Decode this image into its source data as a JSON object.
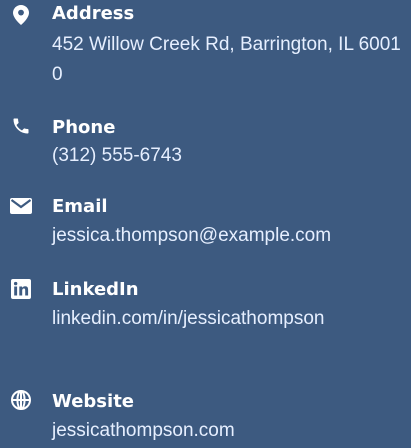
{
  "contact": {
    "items": [
      {
        "icon": "map-pin-icon",
        "label": "Address",
        "value": "452 Willow Creek Rd, Barrington, IL 60010"
      },
      {
        "icon": "phone-icon",
        "label": "Phone",
        "value": "(312) 555-6743"
      },
      {
        "icon": "envelope-icon",
        "label": "Email",
        "value": "jessica.thompson@example.com"
      },
      {
        "icon": "linkedin-icon",
        "label": "LinkedIn",
        "value": "linkedin.com/in/jessicathompson"
      },
      {
        "icon": "globe-icon",
        "label": "Website",
        "value": "jessicathompson.com"
      }
    ]
  },
  "colors": {
    "background": "#3d5a80",
    "text": "#ffffff"
  }
}
